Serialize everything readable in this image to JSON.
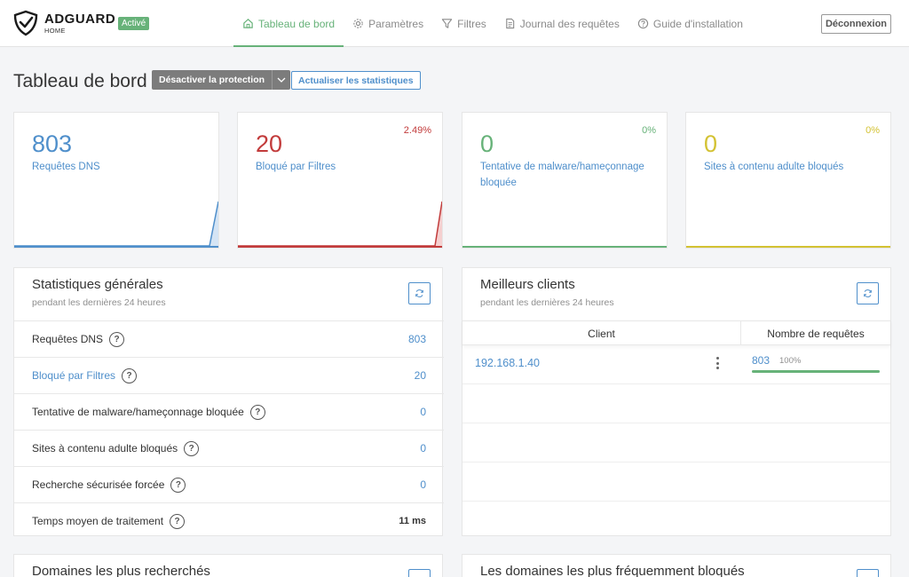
{
  "app": {
    "brand": "ADGUARD",
    "brand_sub": "HOME",
    "status_badge": "Activé",
    "logout": "Déconnexion"
  },
  "nav": [
    {
      "label": "Tableau de bord",
      "icon": "home-icon",
      "active": true
    },
    {
      "label": "Paramètres",
      "icon": "gear-icon",
      "active": false
    },
    {
      "label": "Filtres",
      "icon": "filter-icon",
      "active": false
    },
    {
      "label": "Journal des requêtes",
      "icon": "document-icon",
      "active": false
    },
    {
      "label": "Guide d'installation",
      "icon": "help-icon",
      "active": false
    }
  ],
  "page": {
    "title": "Tableau de bord",
    "disable_protection": "Désactiver la protection",
    "refresh_stats": "Actualiser les statistiques"
  },
  "cards": [
    {
      "value": "803",
      "label": "Requêtes DNS",
      "percent": "",
      "color": "#4f8fcb"
    },
    {
      "value": "20",
      "label": "Bloqué par Filtres",
      "percent": "2.49%",
      "color": "#c23b3b"
    },
    {
      "value": "0",
      "label": "Tentative de malware/hameçonnage bloquée",
      "percent": "0%",
      "color": "#67b279"
    },
    {
      "value": "0",
      "label": "Sites à contenu adulte bloqués",
      "percent": "0%",
      "color": "#d3c233"
    }
  ],
  "general_stats": {
    "title": "Statistiques générales",
    "subtitle": "pendant les dernières 24 heures",
    "rows": [
      {
        "label": "Requêtes DNS",
        "value": "803"
      },
      {
        "label": "Bloqué par Filtres",
        "value": "20"
      },
      {
        "label": "Tentative de malware/hameçonnage bloquée",
        "value": "0"
      },
      {
        "label": "Sites à contenu adulte bloqués",
        "value": "0"
      },
      {
        "label": "Recherche sécurisée forcée",
        "value": "0"
      },
      {
        "label": "Temps moyen de traitement",
        "value": "11 ms"
      }
    ]
  },
  "top_clients": {
    "title": "Meilleurs clients",
    "subtitle": "pendant les dernières 24 heures",
    "col_client": "Client",
    "col_requests": "Nombre de requêtes",
    "rows": [
      {
        "client": "192.168.1.40",
        "count": "803",
        "percent": "100%",
        "share": 1.0
      }
    ]
  },
  "bottom": {
    "top_domains_title": "Domaines les plus recherchés",
    "top_blocked_title": "Les domaines les plus fréquemment bloqués"
  }
}
